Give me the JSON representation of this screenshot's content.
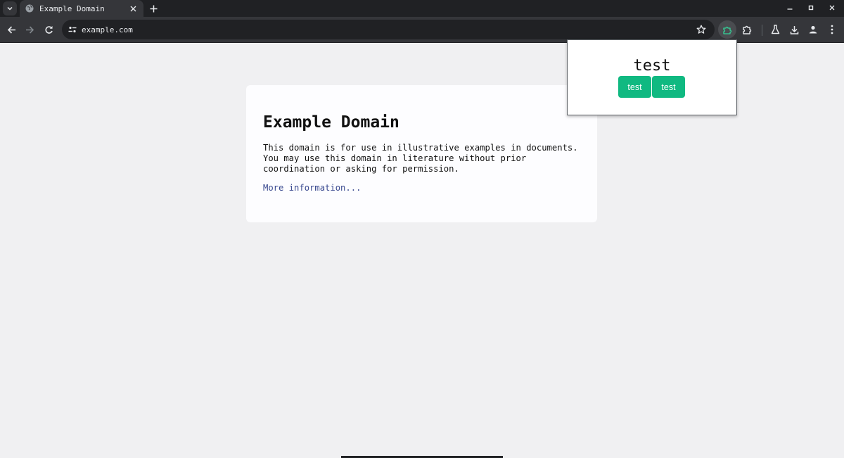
{
  "browser": {
    "tab": {
      "title": "Example Domain"
    },
    "omnibox": {
      "url": "example.com"
    },
    "icons": {
      "tab_search": "chevron-down-icon",
      "favicon": "globe-icon",
      "close_tab": "close-icon",
      "new_tab": "plus-icon",
      "minimize": "minimize-icon",
      "maximize": "maximize-icon",
      "close_window": "close-icon",
      "back": "back-arrow-icon",
      "forward": "forward-arrow-icon",
      "reload": "reload-icon",
      "site_info": "tune-icon",
      "bookmark": "star-icon",
      "extension_active": "puzzle-icon",
      "extensions": "puzzle-icon",
      "labs": "flask-icon",
      "downloads": "download-icon",
      "profile": "person-icon",
      "menu": "kebab-menu-icon"
    }
  },
  "page": {
    "heading": "Example Domain",
    "body": "This domain is for use in illustrative examples in documents. You may use this domain in literature without prior coordination or asking for permission.",
    "link": "More information..."
  },
  "popup": {
    "title": "test",
    "buttons": [
      "test",
      "test"
    ]
  },
  "colors": {
    "toolbar": "#35363a",
    "tabstrip": "#202124",
    "page_bg": "#f0f0f2",
    "link": "#38488f",
    "popup_button": "#10b981"
  }
}
